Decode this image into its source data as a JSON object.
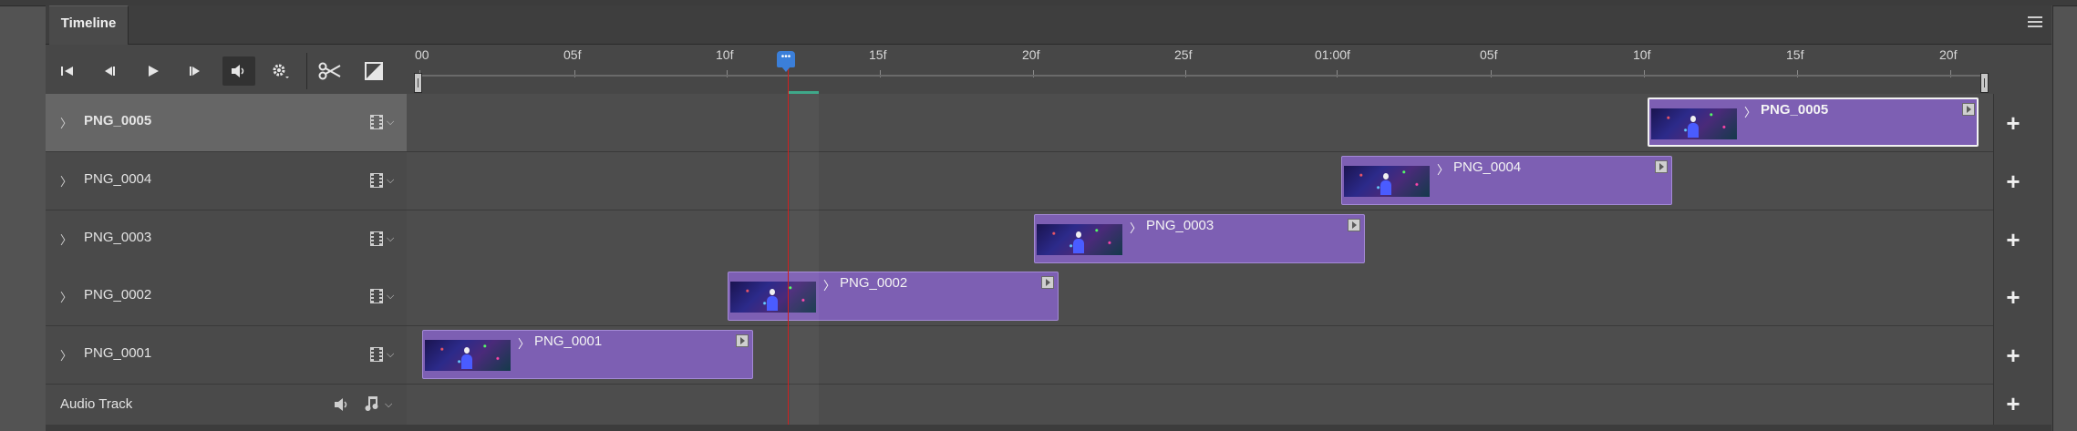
{
  "panel": {
    "tab_label": "Timeline"
  },
  "controls": [
    {
      "name": "go-to-first-frame-button",
      "glyph": "⏮"
    },
    {
      "name": "previous-frame-button",
      "glyph": "⏪"
    },
    {
      "name": "play-button",
      "glyph": "▶"
    },
    {
      "name": "next-frame-button",
      "glyph": "⏩"
    },
    {
      "name": "audio-toggle-button",
      "glyph": "🔊"
    },
    {
      "name": "settings-gear-button",
      "glyph": "⚙"
    },
    {
      "name": "split-at-playhead-button",
      "glyph": "✂"
    },
    {
      "name": "transition-button",
      "glyph": "◪"
    }
  ],
  "ruler": {
    "labels": [
      "00",
      "05f",
      "10f",
      "15f",
      "20f",
      "25f",
      "01:00f",
      "05f",
      "10f",
      "15f",
      "20f"
    ],
    "playhead_glyph": "•••"
  },
  "tracks": [
    {
      "label": "PNG_0005",
      "selected": true
    },
    {
      "label": "PNG_0004",
      "selected": false
    },
    {
      "label": "PNG_0003",
      "selected": false
    },
    {
      "label": "PNG_0002",
      "selected": false
    },
    {
      "label": "PNG_0001",
      "selected": false
    }
  ],
  "clips": [
    {
      "label": "PNG_0005",
      "selected": true
    },
    {
      "label": "PNG_0004",
      "selected": false
    },
    {
      "label": "PNG_0003",
      "selected": false
    },
    {
      "label": "PNG_0002",
      "selected": false
    },
    {
      "label": "PNG_0001",
      "selected": false
    }
  ],
  "audio_track": {
    "label": "Audio Track"
  },
  "track_chevron": "〉",
  "add_glyph": "+",
  "colors": {
    "clip": "#7d5fb3",
    "playhead": "#d02020",
    "playhead_head": "#3b7fd9"
  }
}
